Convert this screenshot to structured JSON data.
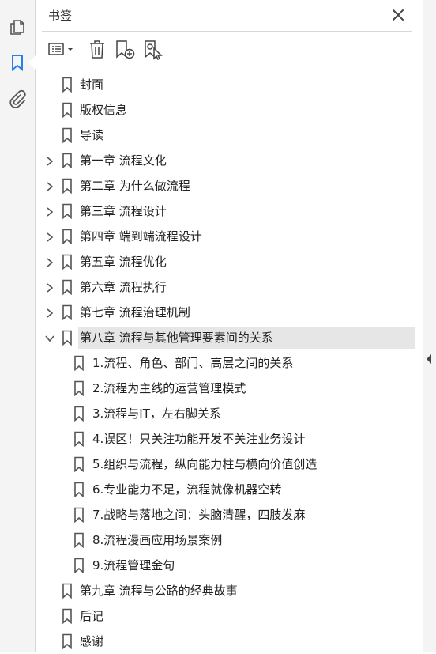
{
  "panel": {
    "title": "书签"
  },
  "sidebar": {
    "icons": [
      "pages-icon",
      "bookmark-icon",
      "attachment-icon"
    ],
    "active": "bookmark-icon",
    "accent": "#2680eb"
  },
  "toolbar": {
    "icons": [
      "options-menu-icon",
      "delete-icon",
      "new-bookmark-icon",
      "bookmark-from-selection-icon"
    ]
  },
  "bookmarks": [
    {
      "label": "封面",
      "level": 0,
      "expander": "none"
    },
    {
      "label": "版权信息",
      "level": 0,
      "expander": "none"
    },
    {
      "label": "导读",
      "level": 0,
      "expander": "none"
    },
    {
      "label": "第一章 流程文化",
      "level": 0,
      "expander": "collapsed"
    },
    {
      "label": "第二章 为什么做流程",
      "level": 0,
      "expander": "collapsed"
    },
    {
      "label": "第三章 流程设计",
      "level": 0,
      "expander": "collapsed"
    },
    {
      "label": "第四章 端到端流程设计",
      "level": 0,
      "expander": "collapsed"
    },
    {
      "label": "第五章 流程优化",
      "level": 0,
      "expander": "collapsed"
    },
    {
      "label": "第六章 流程执行",
      "level": 0,
      "expander": "collapsed"
    },
    {
      "label": "第七章 流程治理机制",
      "level": 0,
      "expander": "collapsed"
    },
    {
      "label": "第八章 流程与其他管理要素间的关系",
      "level": 0,
      "expander": "expanded",
      "selected": true
    },
    {
      "label": "1.流程、角色、部门、高层之间的关系",
      "level": 1,
      "expander": "none"
    },
    {
      "label": "2.流程为主线的运营管理模式",
      "level": 1,
      "expander": "none"
    },
    {
      "label": "3.流程与IT，左右脚关系",
      "level": 1,
      "expander": "none"
    },
    {
      "label": "4.误区！只关注功能开发不关注业务设计",
      "level": 1,
      "expander": "none"
    },
    {
      "label": "5.组织与流程，纵向能力柱与横向价值创造",
      "level": 1,
      "expander": "none"
    },
    {
      "label": "6.专业能力不足，流程就像机器空转",
      "level": 1,
      "expander": "none"
    },
    {
      "label": "7.战略与落地之间：头脑清醒，四肢发麻",
      "level": 1,
      "expander": "none"
    },
    {
      "label": "8.流程漫画应用场景案例",
      "level": 1,
      "expander": "none"
    },
    {
      "label": "9.流程管理金句",
      "level": 1,
      "expander": "none"
    },
    {
      "label": "第九章 流程与公路的经典故事",
      "level": 0,
      "expander": "none"
    },
    {
      "label": "后记",
      "level": 0,
      "expander": "none"
    },
    {
      "label": "感谢",
      "level": 0,
      "expander": "none"
    }
  ]
}
